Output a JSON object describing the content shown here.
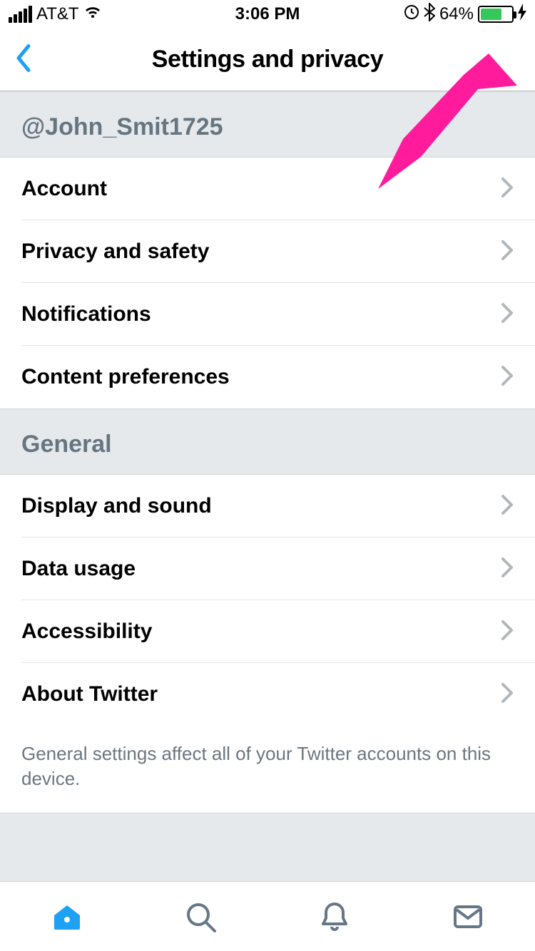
{
  "statusbar": {
    "carrier": "AT&T",
    "time": "3:06 PM",
    "battery_percent": "64%",
    "battery_fill_percent": 64
  },
  "nav": {
    "title": "Settings and privacy"
  },
  "sections": {
    "user": {
      "header": "@John_Smit1725",
      "items": [
        {
          "label": "Account"
        },
        {
          "label": "Privacy and safety"
        },
        {
          "label": "Notifications"
        },
        {
          "label": "Content preferences"
        }
      ]
    },
    "general": {
      "header": "General",
      "items": [
        {
          "label": "Display and sound"
        },
        {
          "label": "Data usage"
        },
        {
          "label": "Accessibility"
        },
        {
          "label": "About Twitter"
        }
      ],
      "footer": "General settings affect all of your Twitter accounts on this device."
    }
  },
  "tabs": [
    "home",
    "search",
    "notifications",
    "messages"
  ],
  "annotation": {
    "arrow_color": "#ff1b9c"
  }
}
